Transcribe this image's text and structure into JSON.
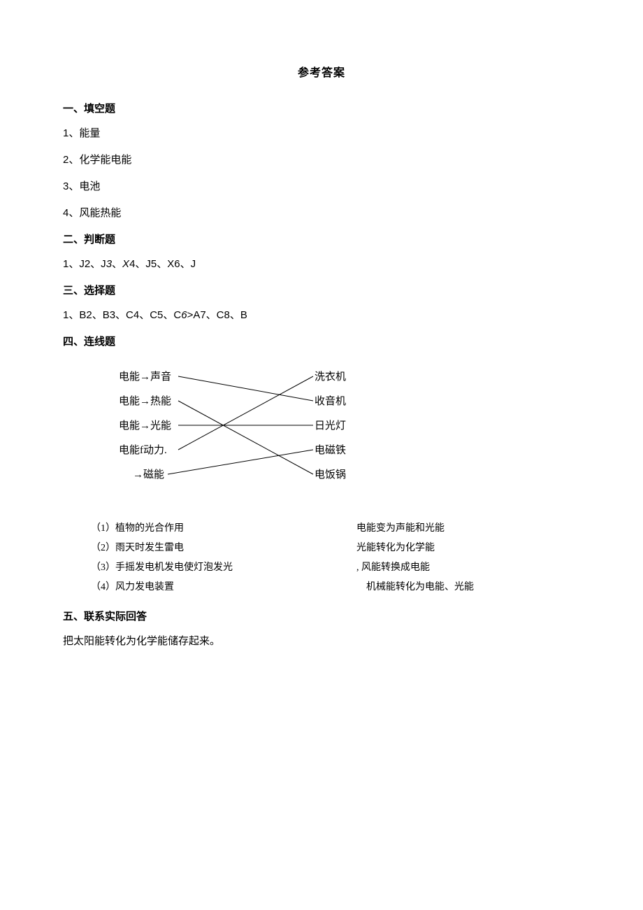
{
  "title": "参考答案",
  "sections": {
    "s1": {
      "head": "一、填空题",
      "a1": "1、能量",
      "a2": "2、化学能电能",
      "a3": "3、电池",
      "a4": "4、风能热能"
    },
    "s2": {
      "head": "二、判断题",
      "a1_pre": "1、J2、J",
      "a1_it1": "3",
      "a1_mid1": "、",
      "a1_it2": "X",
      "a1_mid2": "4、J5、X6、J"
    },
    "s3": {
      "head": "三、选择题",
      "a1_pre": "1、B2、B3、C4、C5、C",
      "a1_it": "6",
      "a1_post": ">A7、C8、B"
    },
    "s4": {
      "head": "四、连线题",
      "left": {
        "l1": "电能→声音",
        "l2": "电能→热能",
        "l3": "电能→光能",
        "l4": "电能f动力.",
        "l5": "→磁能"
      },
      "right": {
        "r1": "洗衣机",
        "r2": "收音机",
        "r3": "日光灯",
        "r4": "电磁铁",
        "r5": "电饭锅"
      },
      "match2": {
        "left": {
          "m1": "（1）植物的光合作用",
          "m2": "（2）雨天时发生雷电",
          "m3": "（3）手摇发电机发电使灯泡发光",
          "m4": "（4）风力发电装置"
        },
        "right": {
          "m1": "电能变为声能和光能",
          "m2": "光能转化为化学能",
          "m3": ", 风能转换成电能",
          "m4": "　机械能转化为电能、光能"
        }
      }
    },
    "s5": {
      "head": "五、联系实际回答",
      "a1": "把太阳能转化为化学能储存起来。"
    }
  }
}
